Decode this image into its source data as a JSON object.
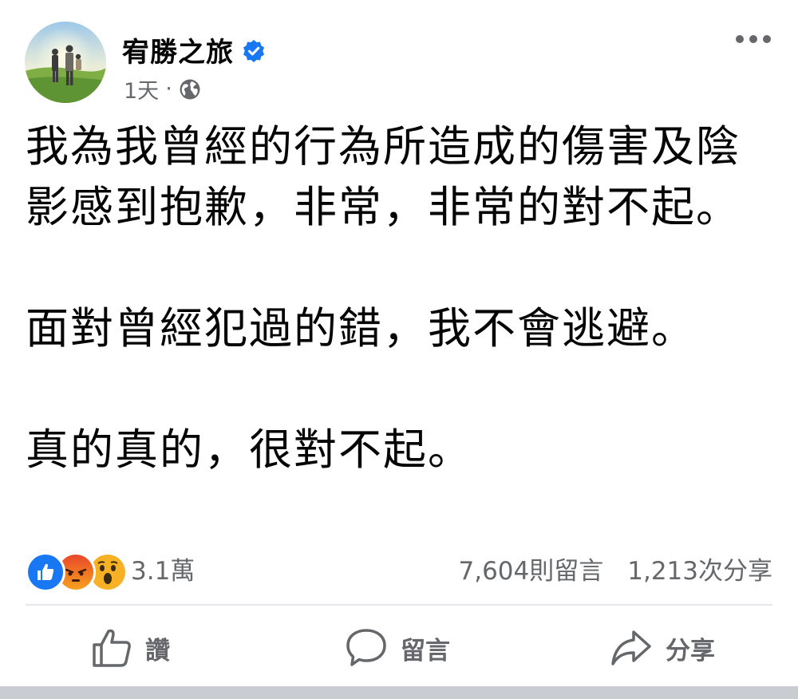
{
  "post": {
    "author": "宥勝之旅",
    "verified_icon": "verified-badge-icon",
    "time": "1天",
    "separator": "·",
    "privacy_icon": "globe-icon",
    "more_icon": "more-options-icon",
    "paragraphs": [
      "我為我曾經的行為所造成的傷害及陰影感到抱歉，非常，非常的對不起。",
      "面對曾經犯過的錯，我不會逃避。",
      "真的真的，很對不起。"
    ]
  },
  "stats": {
    "reaction_icons": [
      "like-icon",
      "angry-icon",
      "wow-icon"
    ],
    "reactions_count": "3.1萬",
    "comments": "7,604則留言",
    "shares": "1,213次分享"
  },
  "actions": {
    "like": "讚",
    "comment": "留言",
    "share": "分享"
  },
  "colors": {
    "text": "#050505",
    "secondary": "#65676b",
    "like_blue": "#1877f2",
    "angry": "#f0511c",
    "wow": "#f7b125",
    "divider": "#e4e6eb"
  }
}
